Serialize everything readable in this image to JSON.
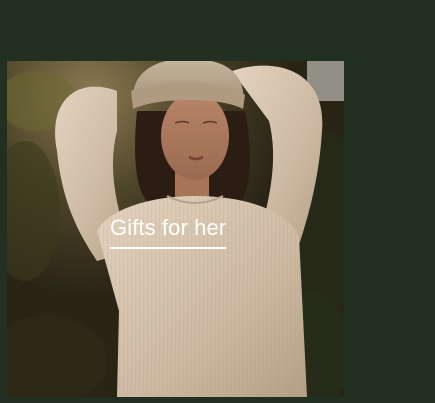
{
  "page": {
    "background_color": "#213021"
  },
  "promo": {
    "caption": "Gifts for her",
    "image_subject": "woman-in-beanie-and-sweater-photo",
    "caption_color": "#ffffff"
  }
}
